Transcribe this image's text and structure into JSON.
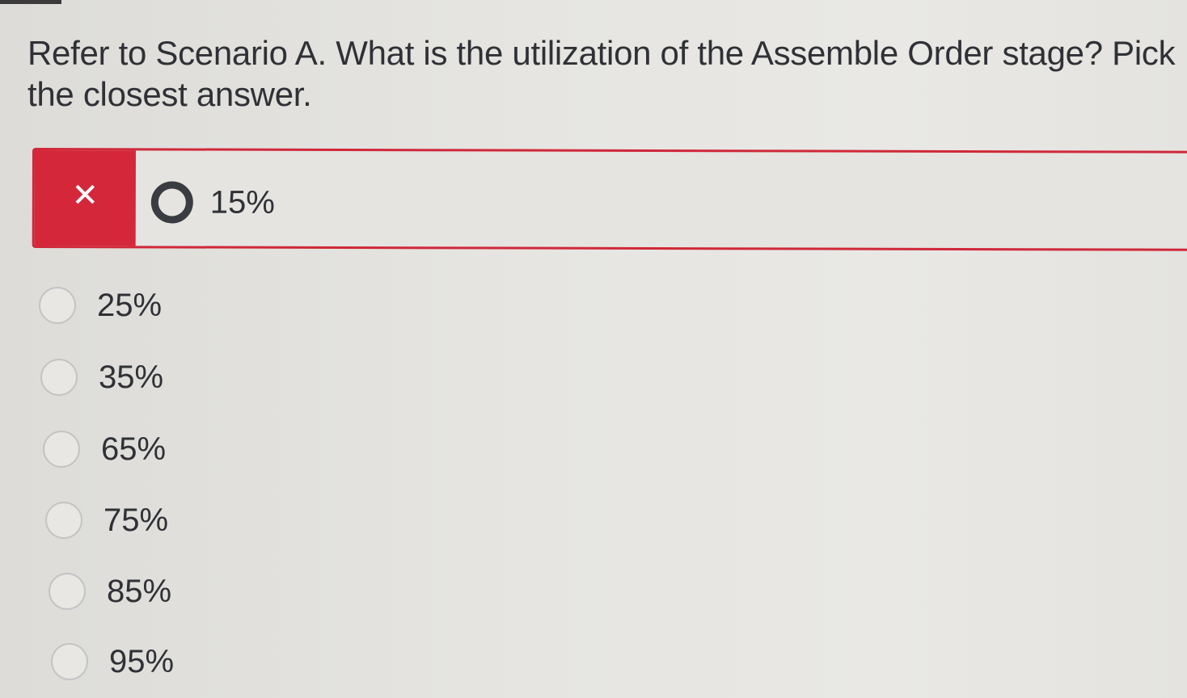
{
  "question": {
    "text": "Refer to Scenario A. What is the utilization of the Assemble Order stage? Pick the closest answer."
  },
  "selected_answer": {
    "label": "15%",
    "status": "incorrect",
    "status_icon": "close-icon",
    "status_glyph": "✕",
    "status_color": "#d4283a"
  },
  "options": [
    {
      "label": "25%"
    },
    {
      "label": "35%"
    },
    {
      "label": "65%"
    },
    {
      "label": "75%"
    },
    {
      "label": "85%"
    },
    {
      "label": "95%"
    }
  ]
}
